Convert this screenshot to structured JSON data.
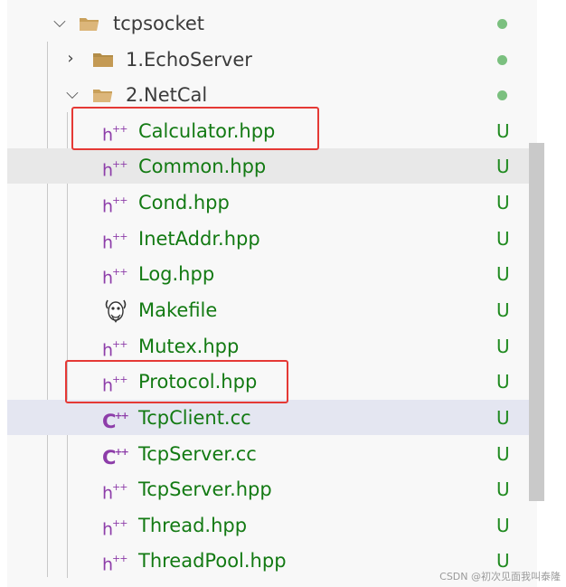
{
  "explorer": {
    "folders": [
      {
        "label": "tcpsocket",
        "expanded": true,
        "icon": "folder-open-icon"
      },
      {
        "label": "1.EchoServer",
        "expanded": false,
        "icon": "folder-closed-icon"
      },
      {
        "label": "2.NetCal",
        "expanded": true,
        "icon": "folder-open-icon"
      }
    ],
    "files": [
      {
        "name": "Calculator.hpp",
        "icon": "cpp-header-icon",
        "status": "U"
      },
      {
        "name": "Common.hpp",
        "icon": "cpp-header-icon",
        "status": "U"
      },
      {
        "name": "Cond.hpp",
        "icon": "cpp-header-icon",
        "status": "U"
      },
      {
        "name": "InetAddr.hpp",
        "icon": "cpp-header-icon",
        "status": "U"
      },
      {
        "name": "Log.hpp",
        "icon": "cpp-header-icon",
        "status": "U"
      },
      {
        "name": "Makefile",
        "icon": "gnu-makefile-icon",
        "status": "U"
      },
      {
        "name": "Mutex.hpp",
        "icon": "cpp-header-icon",
        "status": "U"
      },
      {
        "name": "Protocol.hpp",
        "icon": "cpp-header-icon",
        "status": "U"
      },
      {
        "name": "TcpClient.cc",
        "icon": "cpp-source-icon",
        "status": "U"
      },
      {
        "name": "TcpServer.cc",
        "icon": "cpp-source-icon",
        "status": "U"
      },
      {
        "name": "TcpServer.hpp",
        "icon": "cpp-header-icon",
        "status": "U"
      },
      {
        "name": "Thread.hpp",
        "icon": "cpp-header-icon",
        "status": "U"
      },
      {
        "name": "ThreadPool.hpp",
        "icon": "cpp-header-icon",
        "status": "U"
      }
    ]
  },
  "icon_glyphs": {
    "header": "h",
    "header_sup": "++",
    "source": "C",
    "source_sup": "++"
  },
  "colors": {
    "file_untracked": "#137a13",
    "folder_dot": "#7bc07f",
    "header_icon": "#8d3da9",
    "highlight_box": "#e53935",
    "selected_row": "#e4e6f1",
    "hover_row": "#e8e8e8"
  },
  "watermark": "CSDN @初次见面我叫泰隆"
}
